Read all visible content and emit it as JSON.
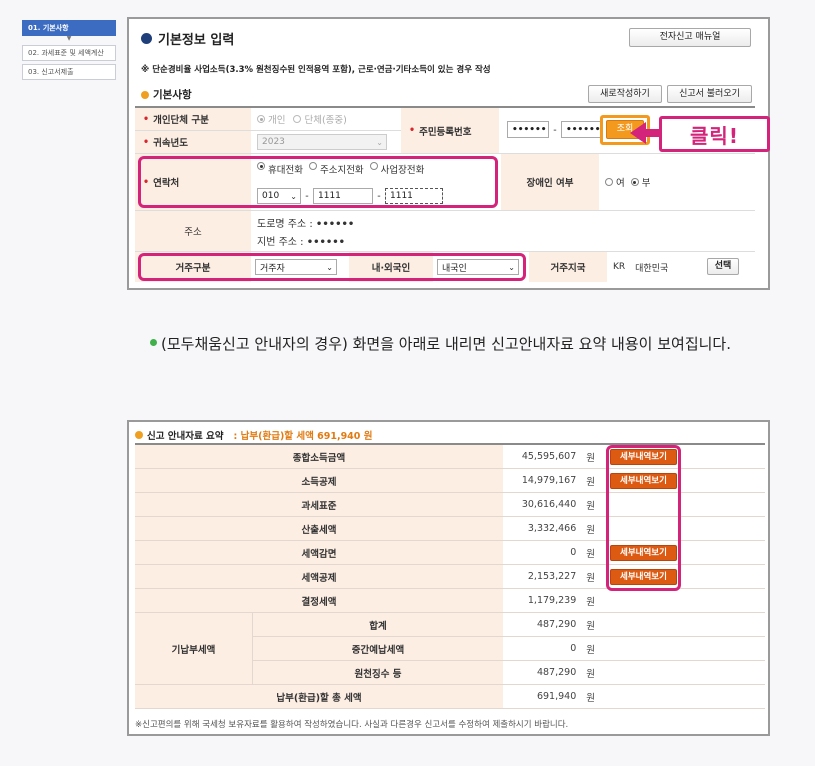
{
  "steps": [
    {
      "label": "01. 기본사항",
      "active": true
    },
    {
      "label": "02. 과세표준 및 세액계산",
      "active": false
    },
    {
      "label": "03. 신고서제출",
      "active": false
    }
  ],
  "panel1": {
    "title": "기본정보 입력",
    "manual_btn": "전자신고 매뉴얼",
    "note": "※ 단순경비율 사업소득(3.3% 원천징수된 인적용역 포함), 근로·연금·기타소득이 있는 경우 작성",
    "section": "기본사항",
    "new_btn": "새로작성하기",
    "load_btn": "신고서 불러오기",
    "type_label": "개인단체 구분",
    "type_opts": [
      "개인",
      "단체(종중)"
    ],
    "year_label": "귀속년도",
    "year_value": "2023",
    "ssn_label": "주민등록번호",
    "ssn_front": "••••••",
    "ssn_dash": "-",
    "ssn_back": "••••••",
    "lookup_btn": "조회",
    "contact_label": "연락처",
    "contact_opts": [
      "휴대전화",
      "주소지전화",
      "사업장전화"
    ],
    "phone1": "010",
    "phone2": "1111",
    "phone3": "1111",
    "disabled_label": "장애인 여부",
    "disabled_opts": [
      "여",
      "부"
    ],
    "address_label": "주소",
    "road_addr": "도로명 주소 :",
    "road_val": "••••••",
    "lot_addr": "지번 주소 :",
    "lot_val": "••••••",
    "residence_label": "거주구분",
    "residence_value": "거주자",
    "nation_label": "내·외국인",
    "nation_value": "내국인",
    "country_label": "거주지국",
    "country_code": "KR",
    "country_name": "대한민국",
    "select_btn": "선택",
    "callout": "클릭!"
  },
  "paragraph": "(모두채움신고 안내자의 경우) 화면을 아래로 내리면 신고안내자료 요약 내용이 보여집니다.",
  "panel2": {
    "title": "신고 안내자료 요약",
    "total": ": 납부(환급)할 세액 691,940 원",
    "detail_btn": "세부내역보기",
    "unit": "원",
    "group_label": "기납부세액",
    "rows": [
      {
        "label": "종합소득금액",
        "value": "45,595,607"
      },
      {
        "label": "소득공제",
        "value": "14,979,167"
      },
      {
        "label": "과세표준",
        "value": "30,616,440"
      },
      {
        "label": "산출세액",
        "value": "3,332,466"
      },
      {
        "label": "세액감면",
        "value": "0"
      },
      {
        "label": "세액공제",
        "value": "2,153,227"
      },
      {
        "label": "결정세액",
        "value": "1,179,239"
      },
      {
        "label": "합계",
        "value": "487,290"
      },
      {
        "label": "중간예납세액",
        "value": "0"
      },
      {
        "label": "원천징수 등",
        "value": "487,290"
      },
      {
        "label": "납부(환급)할 총 세액",
        "value": "691,940"
      }
    ],
    "footnote": "※신고편의를 위해 국세청 보유자료를 활용하여 작성하였습니다. 사실과 다른경우 신고서를 수정하여 제출하시기 바랍니다."
  },
  "colors": {
    "accent_pink": "#d4237a",
    "accent_orange": "#f39a1e",
    "navy": "#1f3f7a",
    "detail_btn": "#dc5a12"
  }
}
